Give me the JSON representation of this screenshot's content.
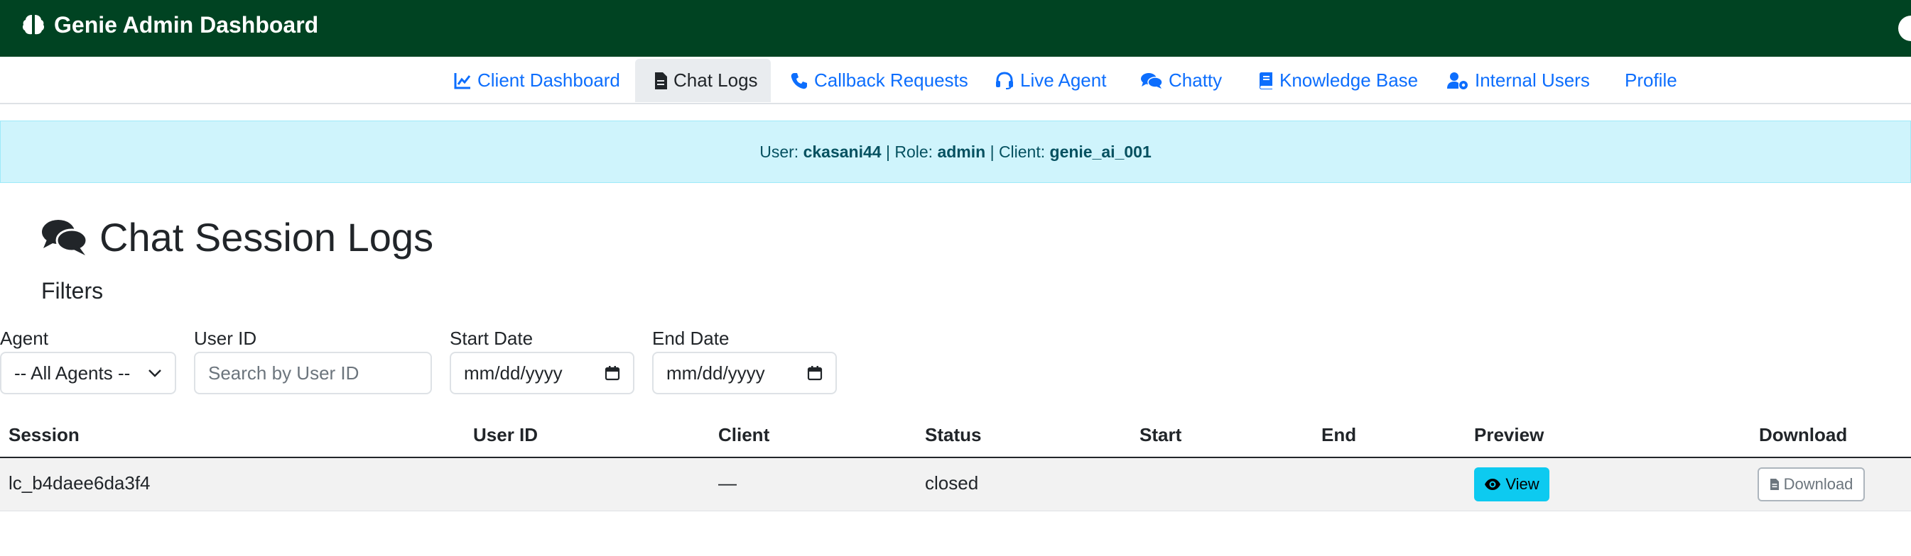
{
  "header": {
    "title": "Genie Admin Dashboard",
    "icon": "brain-icon"
  },
  "nav": {
    "items": [
      {
        "label": "Client Dashboard",
        "icon": "chart-line-icon",
        "active": false
      },
      {
        "label": "Chat Logs",
        "icon": "file-icon",
        "active": true
      },
      {
        "label": "Callback Requests",
        "icon": "phone-icon",
        "active": false
      },
      {
        "label": "Live Agent",
        "icon": "headset-icon",
        "active": false
      },
      {
        "label": "Chatty",
        "icon": "comments-icon",
        "active": false
      },
      {
        "label": "Knowledge Base",
        "icon": "book-icon",
        "active": false
      },
      {
        "label": "Internal Users",
        "icon": "user-gear-icon",
        "active": false
      },
      {
        "label": "Profile",
        "icon": "",
        "active": false
      }
    ],
    "link_color": "#0d6efd"
  },
  "info": {
    "user_label": "User:",
    "user": "ckasani44",
    "role_label": "Role:",
    "role": "admin",
    "client_label": "Client:",
    "client": "genie_ai_001",
    "separator": "|"
  },
  "page": {
    "title": "Chat Session Logs",
    "icon": "comments-icon",
    "filters_heading": "Filters"
  },
  "filters": {
    "agent": {
      "label": "Agent",
      "value": "-- All Agents --"
    },
    "user_id": {
      "label": "User ID",
      "placeholder": "Search by User ID"
    },
    "start_date": {
      "label": "Start Date",
      "placeholder": "mm/dd/yyyy"
    },
    "end_date": {
      "label": "End Date",
      "placeholder": "mm/dd/yyyy"
    }
  },
  "table": {
    "columns": [
      "Session",
      "User ID",
      "Client",
      "Status",
      "Start",
      "End",
      "Preview",
      "Download"
    ],
    "rows": [
      {
        "session": "lc_b4daee6da3f4",
        "user_id": "",
        "client": "—",
        "status": "closed",
        "start": "",
        "end": "",
        "preview_label": "View",
        "download_label": "Download"
      }
    ]
  },
  "colors": {
    "topbar": "#004322",
    "alert_bg": "#cff4fc",
    "view_button": "#0dcaf0"
  }
}
